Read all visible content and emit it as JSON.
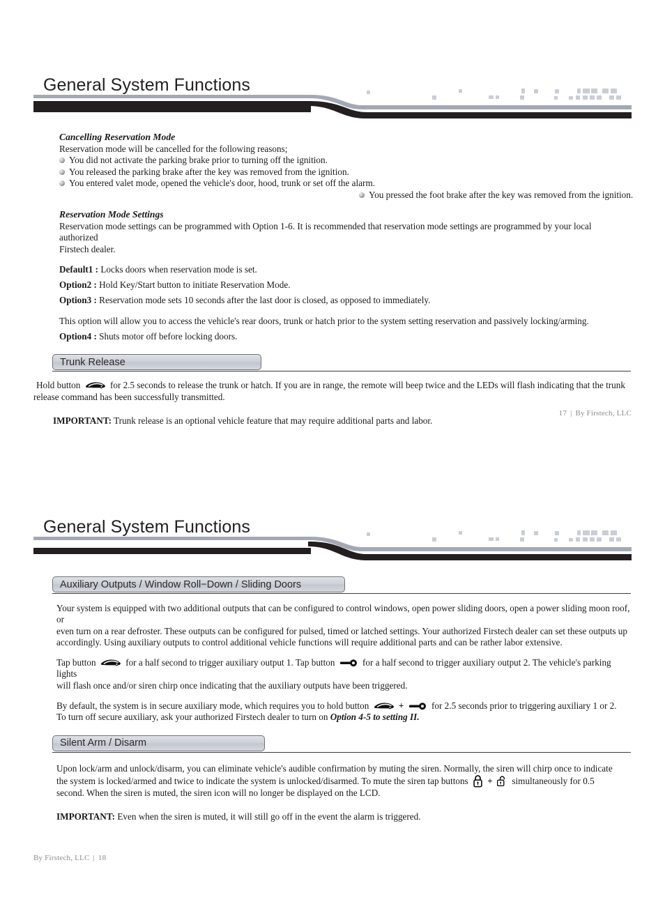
{
  "document": {
    "title": "General System Functions"
  },
  "page1": {
    "header_title": "General System Functions",
    "cancelling": {
      "heading": "Cancelling Reservation Mode",
      "intro": "Reservation mode will be cancelled for the following reasons;",
      "bullets_left": [
        "You did not activate the parking brake prior to turning off the ignition.",
        "You released the parking brake after the key was removed from the ignition.",
        "You entered valet mode, opened the vehicle's door, hood, trunk or set off the alarm."
      ],
      "bullets_right": [
        "You pressed the foot brake after the key was removed from the ignition."
      ]
    },
    "settings": {
      "heading": "Reservation Mode Settings",
      "paragraph_line1": "Reservation mode settings can be programmed with Option 1-6.  It is recommended that reservation mode settings are programmed by your local authorized",
      "paragraph_line2": "Firstech dealer.",
      "options": [
        {
          "label": "Default1 :",
          "text": "Locks doors when reservation mode is set."
        },
        {
          "label": "Option2 :",
          "text": "Hold Key/Start button to initiate Reservation Mode."
        },
        {
          "label": "Option3 :",
          "text": "Reservation mode sets 10 seconds after the last door is closed, as opposed to immediately."
        }
      ],
      "option3_note": "This option will allow you to access the vehicle's rear doors, trunk or hatch prior to the system setting reservation and passively locking/arming.",
      "option4": {
        "label": "Option4 :",
        "text": "Shuts motor off before locking doors."
      }
    },
    "trunk_release": {
      "section_label": "Trunk Release",
      "body_pre_icon": "Hold button",
      "icon": "car-trunk-icon",
      "body_post_icon_line1": "for 2.5 seconds to release the trunk or hatch. If you are in range, the remote will beep twice and the LEDs will flash indicating that the trunk",
      "body_post_icon_line2": "release command has been successfully transmitted.",
      "important_label": "IMPORTANT:",
      "important_text": "Trunk release is an optional vehicle feature that may require additional parts and labor."
    },
    "footer": {
      "page_number": "17",
      "separator": "|",
      "company": "By Firstech, LLC"
    }
  },
  "page2": {
    "header_title": "General System Functions",
    "aux": {
      "section_label": "Auxiliary Outputs / Window Roll−Down / Sliding Doors",
      "para1_line1": "Your system is equipped with two additional outputs that can be configured to control windows, open power sliding doors, open a power sliding moon roof, or",
      "para1_line2": "even turn on a rear defroster. These outputs can be configured for pulsed, timed or latched settings. Your authorized Firstech dealer can set these outputs up",
      "para1_line3": "accordingly. Using auxiliary outputs to control additional vehicle functions will require additional parts and can be rather labor extensive.",
      "para2_seg1": "Tap button",
      "para2_icon1": "car-trunk-icon",
      "para2_seg2": "for a half  second to trigger auxiliary output 1. Tap button",
      "para2_icon2": "key-icon",
      "para2_seg3": "for a half second to trigger auxiliary output 2. The vehicle's parking lights",
      "para2_line2": "will flash once and/or siren chirp once indicating that the auxiliary outputs have been triggered.",
      "para3_seg1": "By default, the system is in secure auxiliary mode, which requires you to hold button",
      "para3_icon1": "car-trunk-icon",
      "para3_plus": "+",
      "para3_icon2": "key-icon",
      "para3_seg2": "for 2.5 seconds prior to triggering auxiliary 1 or 2.",
      "para3_line2_pre": "To turn off secure auxiliary, ask your authorized Firstech dealer to turn on",
      "para3_line2_bold": "Option 4-5 to setting II."
    },
    "silent": {
      "section_label": "Silent Arm / Disarm",
      "para_line1": "Upon lock/arm and unlock/disarm, you can eliminate vehicle's audible confirmation by muting the siren. Normally, the siren will chirp once to indicate",
      "para_line2_pre": "the system is locked/armed and twice to indicate the system is unlocked/disarmed. To mute the siren tap buttons",
      "icon1": "lock-closed-icon",
      "plus": "+",
      "icon2": "lock-open-icon",
      "para_line2_post": "simultaneously for 0.5",
      "para_line3": "second. When the siren is muted, the siren icon will no longer be displayed on the LCD.",
      "important_label": "IMPORTANT:",
      "important_text": "Even when the siren is muted, it will still go off in the event the alarm is triggered."
    },
    "footer": {
      "company": "By Firstech, LLC",
      "separator": "|",
      "page_number": "18"
    }
  }
}
